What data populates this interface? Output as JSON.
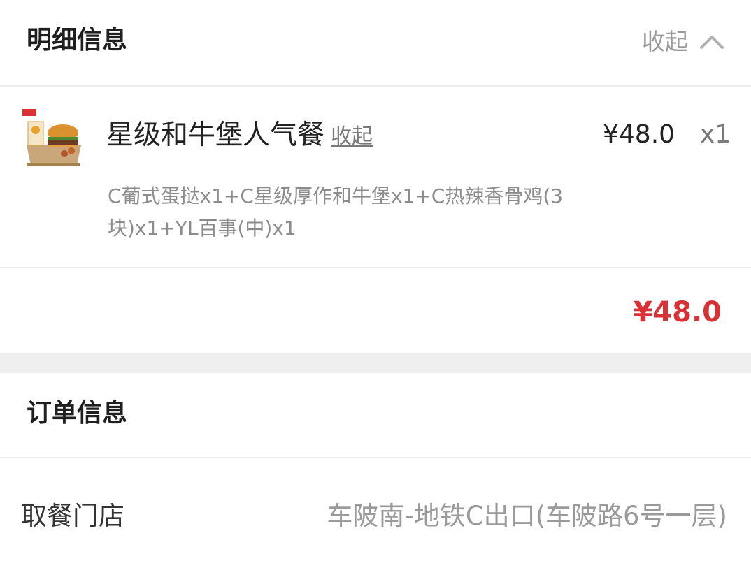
{
  "detail": {
    "title": "明细信息",
    "collapse_label": "收起"
  },
  "item": {
    "name": "星级和牛堡人气餐",
    "collapse_link": "收起",
    "price": "¥48.0",
    "qty": "x1",
    "description": "C葡式蛋挞x1+C星级厚作和牛堡x1+C热辣香骨鸡(3块)x1+YL百事(中)x1",
    "thumbnail_icon": "burger-meal-thumbnail"
  },
  "total": {
    "amount": "¥48.0",
    "color": "#d83236"
  },
  "order": {
    "title": "订单信息",
    "store_label": "取餐门店",
    "store_value": "车陂南-地铁C出口(车陂路6号一层)"
  }
}
